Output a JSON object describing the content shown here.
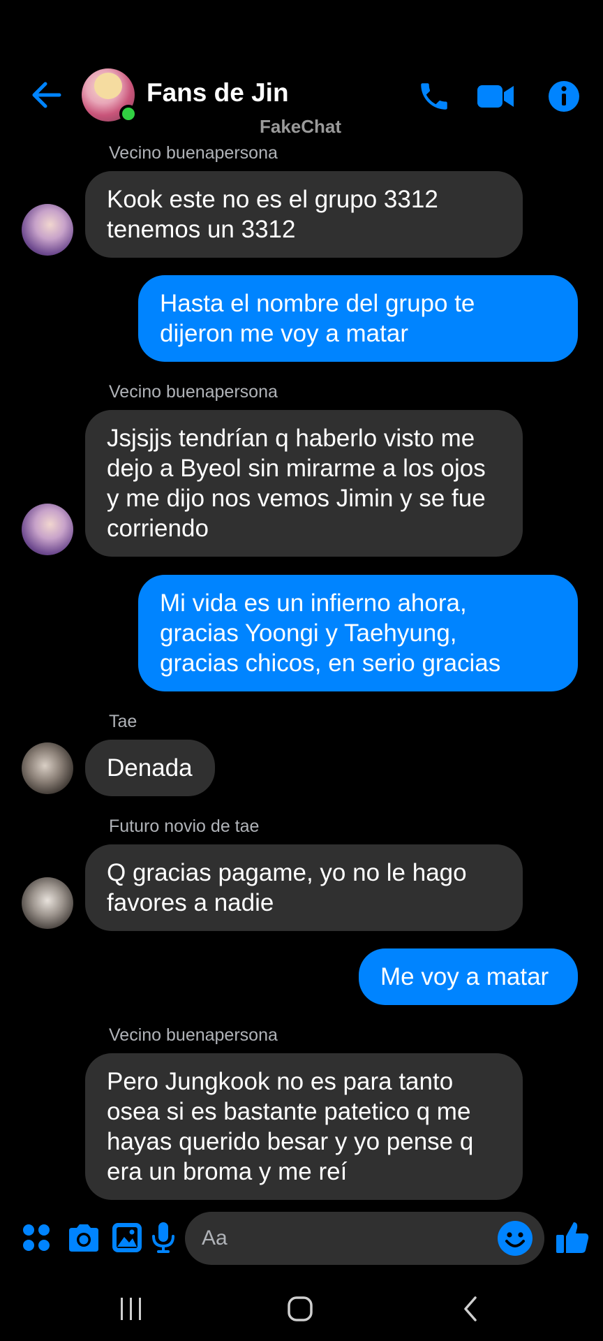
{
  "header": {
    "title": "Fans de Jin",
    "watermark": "FakeChat"
  },
  "messages": [
    {
      "direction": "in",
      "sender": "Vecino buenapersona",
      "avatar": "kook",
      "text": "Kook este no es el grupo 3312\ntenemos un 3312"
    },
    {
      "direction": "out",
      "text": "Hasta el nombre del grupo te\ndijeron me voy a matar"
    },
    {
      "direction": "in",
      "sender": "Vecino buenapersona",
      "avatar": "kook",
      "text": "Jsjsjjs tendrían q haberlo visto me\ndejo a Byeol sin mirarme a los ojos\ny me dijo nos vemos Jimin y se fue\ncorriendo"
    },
    {
      "direction": "out",
      "text": "Mi vida es un infierno ahora,\ngracias  Yoongi y Taehyung,\ngracias chicos, en serio gracias"
    },
    {
      "direction": "in",
      "sender": "Tae",
      "avatar": "tae",
      "text": "Denada"
    },
    {
      "direction": "in",
      "sender": "Futuro novio de tae",
      "avatar": "yoongi",
      "text": "Q gracias pagame, yo no le hago\nfavores a nadie"
    },
    {
      "direction": "out",
      "text": "Me voy a matar"
    },
    {
      "direction": "in",
      "sender": "Vecino buenapersona",
      "avatar": "none",
      "text": "Pero Jungkook no es para tanto\nosea si es bastante patetico q me\nhayas querido besar y yo pense q\nera un broma y me reí"
    }
  ],
  "composer": {
    "placeholder": "Aa"
  },
  "colors": {
    "accent": "#0084ff",
    "incoming_bubble": "#303030",
    "online": "#31d142"
  },
  "icons": {
    "back": "back-arrow-icon",
    "call": "phone-icon",
    "video": "video-camera-icon",
    "info": "info-icon",
    "apps": "apps-grid-icon",
    "camera": "camera-icon",
    "gallery": "image-icon",
    "mic": "microphone-icon",
    "emoji": "emoji-icon",
    "like": "thumbs-up-icon"
  }
}
